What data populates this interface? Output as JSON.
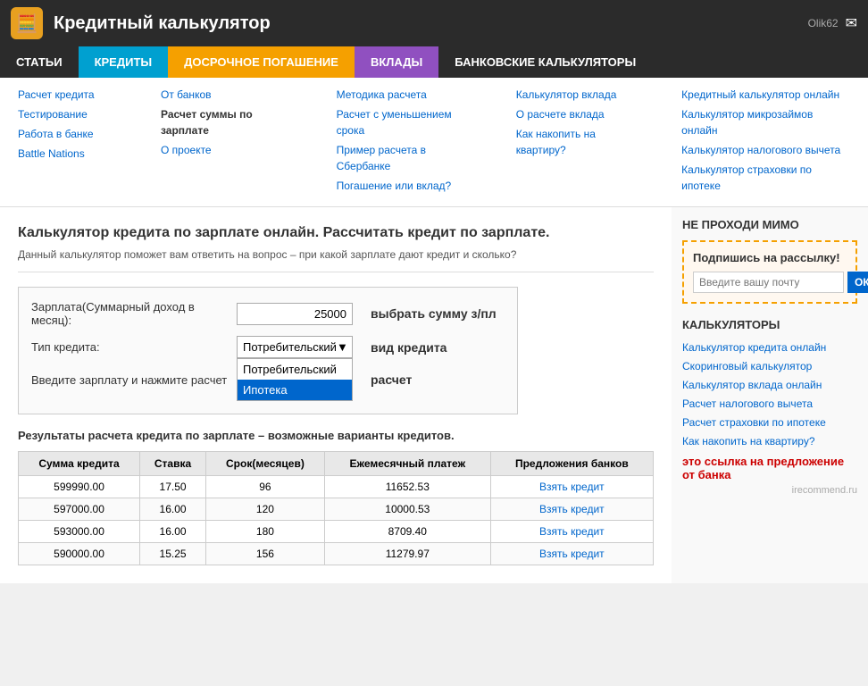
{
  "header": {
    "icon": "🧮",
    "title": "Кредитный калькулятор",
    "user": "Olik62",
    "mail_icon": "✉"
  },
  "navbar": {
    "items": [
      {
        "label": "СТАТЬИ",
        "class": "articles"
      },
      {
        "label": "КРЕДИТЫ",
        "class": "credits"
      },
      {
        "label": "ДОСРОЧНОЕ ПОГАШЕНИЕ",
        "class": "early"
      },
      {
        "label": "ВКЛАДЫ",
        "class": "deposits"
      },
      {
        "label": "БАНКОВСКИЕ КАЛЬКУЛЯТОРЫ",
        "class": "bank-calc"
      }
    ]
  },
  "dropdown": {
    "col1": {
      "links": [
        {
          "text": "Расчет кредита",
          "href": "#"
        },
        {
          "text": "Тестирование",
          "href": "#"
        },
        {
          "text": "Работа в банке",
          "href": "#"
        },
        {
          "text": "Battle Nations",
          "href": "#"
        }
      ]
    },
    "col2": {
      "links": [
        {
          "text": "От банков",
          "href": "#"
        },
        {
          "text": "Расчет суммы по зарплате",
          "href": "#",
          "bold": true
        },
        {
          "text": "О проекте",
          "href": "#"
        }
      ]
    },
    "col3": {
      "links": [
        {
          "text": "Методика расчета",
          "href": "#"
        },
        {
          "text": "Расчет с уменьшением срока",
          "href": "#"
        },
        {
          "text": "Пример расчета в Сбербанке",
          "href": "#"
        },
        {
          "text": "Погашение или вклад?",
          "href": "#"
        }
      ]
    },
    "col4": {
      "links": [
        {
          "text": "Калькулятор вклада",
          "href": "#"
        },
        {
          "text": "О расчете вклада",
          "href": "#"
        },
        {
          "text": "Как накопить на квартиру?",
          "href": "#"
        }
      ]
    },
    "col5": {
      "links": [
        {
          "text": "Кредитный калькулятор онлайн",
          "href": "#"
        },
        {
          "text": "Калькулятор микрозаймов онлайн",
          "href": "#"
        },
        {
          "text": "Калькулятор налогового вычета",
          "href": "#"
        },
        {
          "text": "Калькулятор страховки по ипотеке",
          "href": "#"
        }
      ]
    }
  },
  "main": {
    "title": "Калькулятор кредита по зарплате онлайн. Рассчитать кредит по зарплате.",
    "description": "Данный калькулятор поможет вам ответить на вопрос – при какой зарплате дают кредит и сколько?",
    "form": {
      "salary_label": "Зарплата(Суммарный доход в месяц):",
      "salary_value": "25000",
      "salary_hint": "выбрать сумму з/пл",
      "credit_type_label": "Тип кредита:",
      "credit_type_selected": "Потребительский",
      "credit_type_hint": "вид кредита",
      "credit_type_options": [
        {
          "label": "Потребительский",
          "selected": false
        },
        {
          "label": "Ипотека",
          "selected": true
        }
      ],
      "note": "Введите зарплату и нажмите расчет",
      "note_hint": "расчет"
    },
    "results": {
      "title": "Результаты расчета кредита по зарплате – возможные варианты кредитов.",
      "headers": [
        "Сумма кредита",
        "Ставка",
        "Срок(месяцев)",
        "Ежемесячный платеж",
        "Предложения банков"
      ],
      "rows": [
        {
          "sum": "599990.00",
          "rate": "17.50",
          "term": "96",
          "payment": "11652.53",
          "link": "Взять кредит"
        },
        {
          "sum": "597000.00",
          "rate": "16.00",
          "term": "120",
          "payment": "10000.53",
          "link": "Взять кредит"
        },
        {
          "sum": "593000.00",
          "rate": "16.00",
          "term": "180",
          "payment": "8709.40",
          "link": "Взять кредит"
        },
        {
          "sum": "590000.00",
          "rate": "15.25",
          "term": "156",
          "payment": "11279.97",
          "link": "Взять кредит"
        }
      ]
    }
  },
  "sidebar": {
    "newsletter": {
      "title_upper": "НЕ ПРОХОДИ МИМО",
      "box_title": "Подпишись на рассылку!",
      "placeholder": "Введите вашу почту",
      "btn": "ОК"
    },
    "calculators": {
      "title": "КАЛЬКУЛЯТОРЫ",
      "links": [
        {
          "text": "Калькулятор кредита онлайн",
          "href": "#"
        },
        {
          "text": "Скоринговый калькулятор",
          "href": "#"
        },
        {
          "text": "Калькулятор вклада онлайн",
          "href": "#"
        },
        {
          "text": "Расчет налогового вычета",
          "href": "#"
        },
        {
          "text": "Расчет страховки по ипотеке",
          "href": "#"
        },
        {
          "text": "Как накопить на квартиру?",
          "href": "#"
        }
      ]
    },
    "red_note": "это ссылка на предложение от банка",
    "watermark": "irecommend.ru"
  }
}
